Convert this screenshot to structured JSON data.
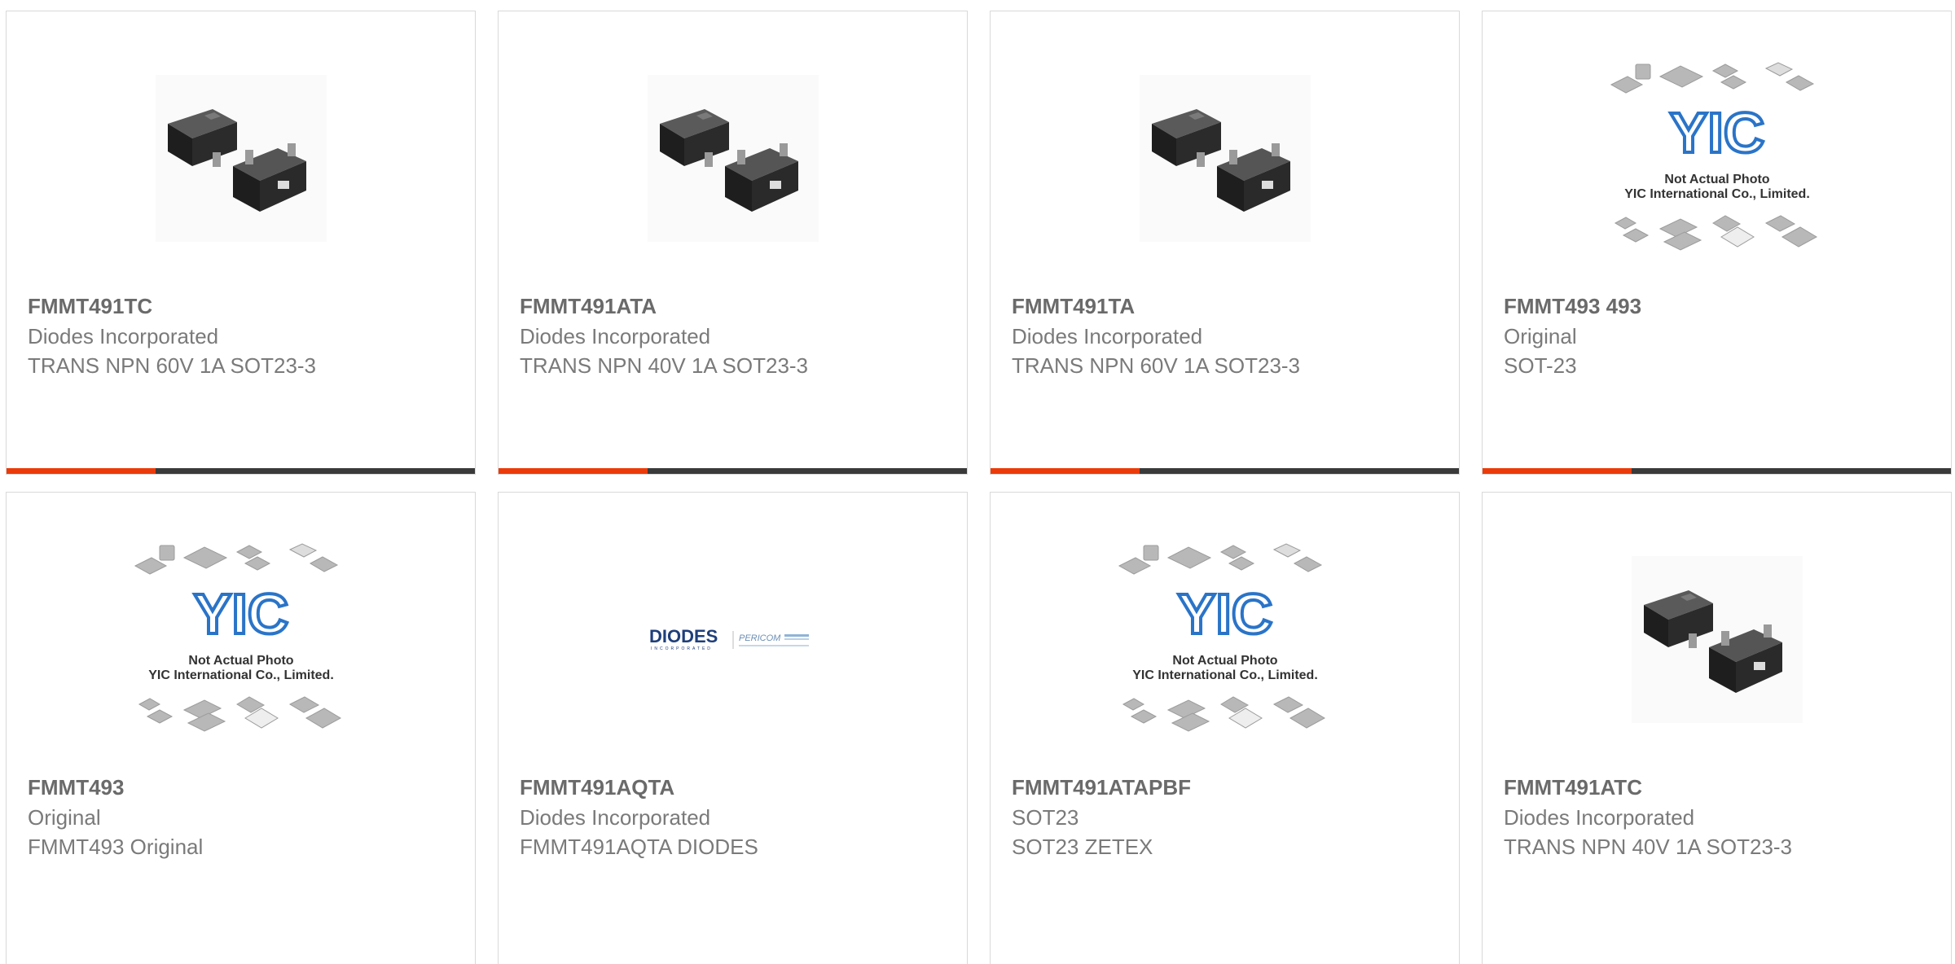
{
  "products": [
    {
      "part_number": "FMMT491TC",
      "manufacturer": "Diodes Incorporated",
      "description": "TRANS NPN 60V 1A SOT23-3",
      "image": "sot23-package"
    },
    {
      "part_number": "FMMT491ATA",
      "manufacturer": "Diodes Incorporated",
      "description": "TRANS NPN 40V 1A SOT23-3",
      "image": "sot23-package"
    },
    {
      "part_number": "FMMT491TA",
      "manufacturer": "Diodes Incorporated",
      "description": "TRANS NPN 60V 1A SOT23-3",
      "image": "sot23-package"
    },
    {
      "part_number": "FMMT493 493",
      "manufacturer": "Original",
      "description": "SOT-23",
      "image": "yic-placeholder"
    },
    {
      "part_number": "FMMT493",
      "manufacturer": "Original",
      "description": "FMMT493 Original",
      "image": "yic-placeholder"
    },
    {
      "part_number": "FMMT491AQTA",
      "manufacturer": "Diodes Incorporated",
      "description": "FMMT491AQTA DIODES",
      "image": "diodes-pericom-logo"
    },
    {
      "part_number": "FMMT491ATAPBF",
      "manufacturer": "SOT23",
      "description": "SOT23 ZETEX",
      "image": "yic-placeholder"
    },
    {
      "part_number": "FMMT491ATC",
      "manufacturer": "Diodes Incorporated",
      "description": "TRANS NPN 40V 1A SOT23-3",
      "image": "sot23-package"
    }
  ],
  "placeholder": {
    "brand": "YIC",
    "line1": "Not Actual Photo",
    "line2": "YIC International Co., Limited."
  },
  "logos": {
    "diodes": "DIODES",
    "diodes_sub": "INCORPORATED",
    "pericom": "PERICOM"
  },
  "colors": {
    "accent": "#ec3b0a",
    "bar": "#3a3a3a",
    "text": "#7a7a7a",
    "diodes_blue": "#1f3f7a",
    "yic_blue": "#2a74c8"
  }
}
